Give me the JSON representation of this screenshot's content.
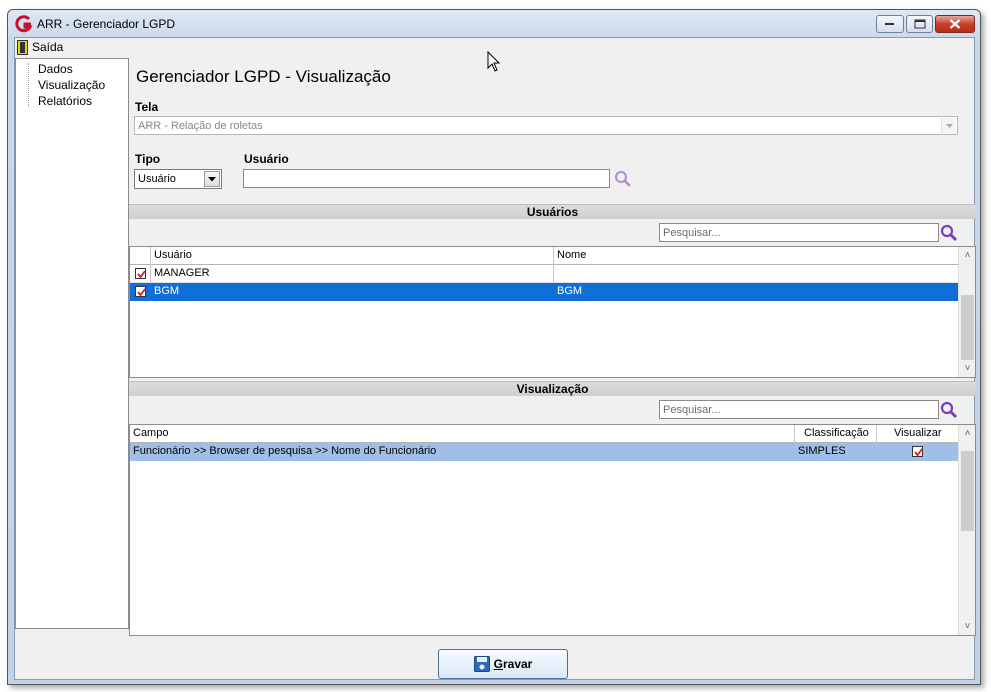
{
  "window": {
    "title": "ARR - Gerenciador LGPD"
  },
  "menu": {
    "exit_label": "Saída"
  },
  "tree": {
    "items": [
      "Dados",
      "Visualização",
      "Relatórios"
    ]
  },
  "page": {
    "title": "Gerenciador LGPD - Visualização"
  },
  "form": {
    "tela_label": "Tela",
    "tela_value": "ARR -  Relação de roletas",
    "tipo_label": "Tipo",
    "tipo_value": "Usuário",
    "usuario_label": "Usuário",
    "usuario_value": ""
  },
  "users_section": {
    "header": "Usuários",
    "search_placeholder": "Pesquisar...",
    "columns": [
      "Usuário",
      "Nome"
    ],
    "rows": [
      {
        "usuario": "MANAGER",
        "nome": "",
        "checked": true,
        "selected": false
      },
      {
        "usuario": "BGM",
        "nome": "BGM",
        "checked": true,
        "selected": true
      }
    ]
  },
  "view_section": {
    "header": "Visualização",
    "search_placeholder": "Pesquisar...",
    "columns": [
      "Campo",
      "Classificação",
      "Visualizar"
    ],
    "rows": [
      {
        "campo": "Funcionário >> Browser de pesquisa >> Nome do Funcionário",
        "classificacao": "SIMPLES",
        "visualizar": true
      }
    ]
  },
  "actions": {
    "save_label": "Gravar",
    "save_accel": "G",
    "save_rest": "ravar"
  },
  "colors": {
    "selection": "#0f6fd6",
    "selection_light": "#9fbfe8",
    "search_icon": "#7b3fb5",
    "check": "#d22020"
  }
}
